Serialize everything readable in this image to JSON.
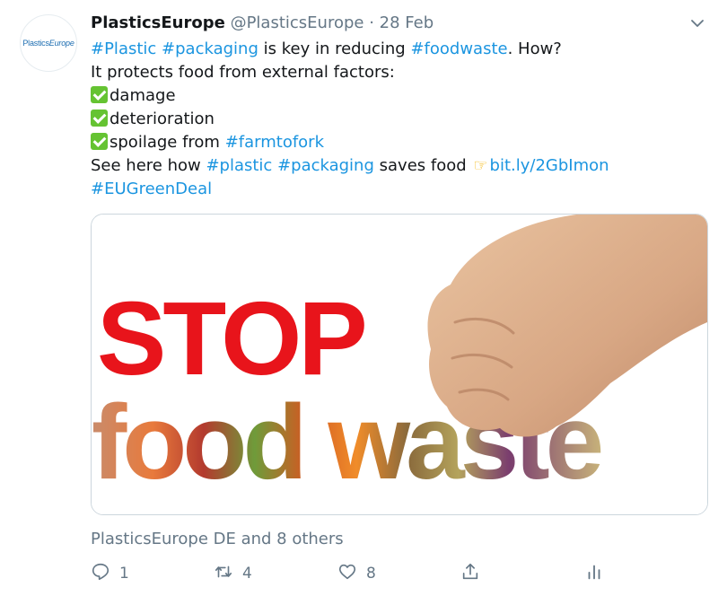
{
  "avatar": {
    "logo_text": "Plastics",
    "logo_text_italic": "Europe"
  },
  "header": {
    "name": "PlasticsEurope",
    "handle": "@PlasticsEurope",
    "separator": "·",
    "date": "28 Feb"
  },
  "tweet": {
    "l1_tag1": "#Plastic",
    "l1_tag2": "#packaging",
    "l1_text1": " is key in reducing ",
    "l1_tag3": "#foodwaste",
    "l1_text2": ". How?",
    "l2": "It protects food from external factors:",
    "l3": "damage",
    "l4": "deterioration",
    "l5_text": "spoilage from ",
    "l5_tag": "#farmtofork",
    "l6_text1": "See here how ",
    "l6_tag1": "#plastic",
    "l6_tag2": "#packaging",
    "l6_text2": " saves food ",
    "l6_link": "bit.ly/2GbImon",
    "l7_tag": "#EUGreenDeal"
  },
  "media": {
    "word1": "STOP",
    "word2": "food waste"
  },
  "likers": "PlasticsEurope DE and 8 others",
  "actions": {
    "replies": "1",
    "retweets": "4",
    "likes": "8"
  },
  "colors": {
    "link": "#1b95e0",
    "muted": "#657786",
    "stop_red": "#e8141b",
    "check_green": "#65c332"
  },
  "icons": [
    "chevron-down-icon",
    "check-mark-icon",
    "pointing-hand-icon",
    "reply-icon",
    "retweet-icon",
    "heart-icon",
    "share-icon",
    "analytics-icon"
  ]
}
